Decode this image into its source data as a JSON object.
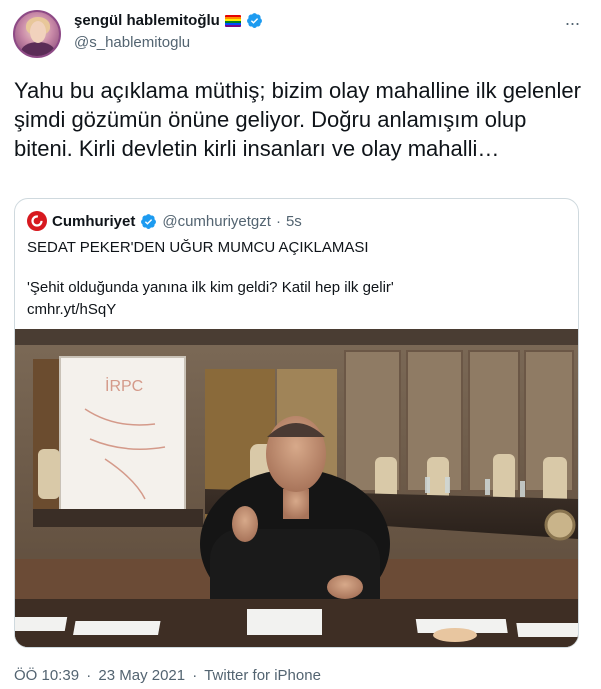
{
  "author": {
    "display_name": "şengül hablemitoğlu",
    "handle": "@s_hablemitoglu",
    "pride_flag_colors": [
      "#e40303",
      "#ff8c00",
      "#ffed00",
      "#008026",
      "#004dff",
      "#750787"
    ]
  },
  "tweet": {
    "text": "Yahu bu açıklama müthiş; bizim olay mahalline ilk gelenler şimdi gözümün önüne geliyor. Doğru anlamışım olup biteni. Kirli devletin kirli insanları ve olay mahalli…"
  },
  "quoted": {
    "display_name": "Cumhuriyet",
    "handle": "@cumhuriyetgzt",
    "dot": "·",
    "time": "5s",
    "title": "SEDAT PEKER'DEN UĞUR MUMCU AÇIKLAMASI",
    "body": "'Şehit olduğunda yanına ilk kim geldi? Katil hep ilk gelir'",
    "link": "cmhr.yt/hSqY"
  },
  "meta": {
    "time": "ÖÖ 10:39",
    "separator": "·",
    "date": "23 May 2021",
    "source": "Twitter for iPhone"
  },
  "colors": {
    "verified": "#1d9bf0",
    "cumhuriyet_red": "#d7191f",
    "secondary_text": "#536471",
    "border": "#cfd9de"
  },
  "icons": {
    "verified": "verified-badge-icon",
    "more": "more-options-icon",
    "flag": "rainbow-flag-icon"
  }
}
